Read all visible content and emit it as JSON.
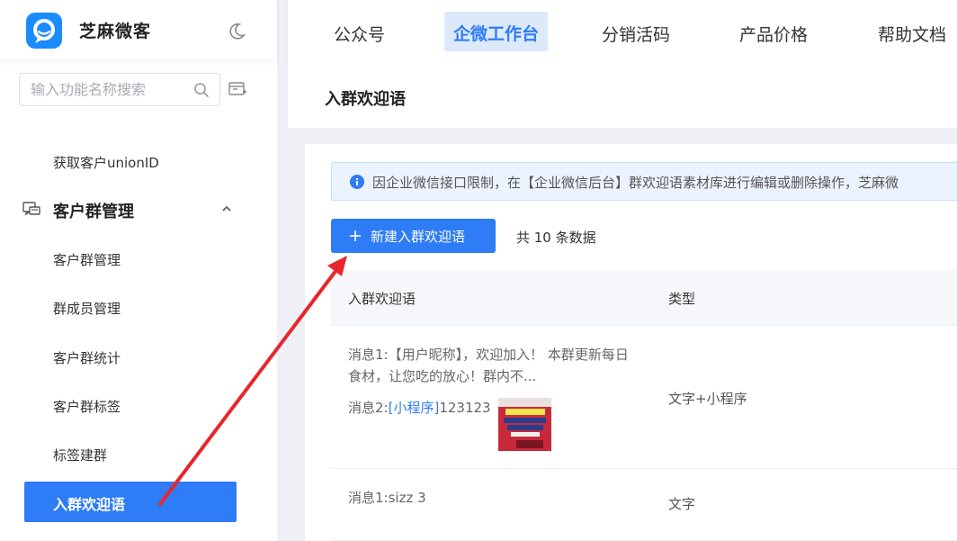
{
  "brand": {
    "name": "芝麻微客"
  },
  "search": {
    "placeholder": "输入功能名称搜索"
  },
  "sidebar": {
    "item_unionid": "获取客户unionID",
    "group_title": "客户群管理",
    "items": [
      {
        "label": "客户群管理"
      },
      {
        "label": "群成员管理"
      },
      {
        "label": "客户群统计"
      },
      {
        "label": "客户群标签"
      },
      {
        "label": "标签建群"
      }
    ],
    "active_label": "入群欢迎语"
  },
  "topnav": {
    "tabs": [
      {
        "label": "公众号"
      },
      {
        "label": "企微工作台"
      },
      {
        "label": "分销活码"
      },
      {
        "label": "产品价格"
      },
      {
        "label": "帮助文档"
      }
    ],
    "active_index": 1
  },
  "page": {
    "title": "入群欢迎语"
  },
  "notice": {
    "text": "因企业微信接口限制，在【企业微信后台】群欢迎语素材库进行编辑或删除操作，芝麻微"
  },
  "toolbar": {
    "new_label": "新建入群欢迎语",
    "count_text": "共 10 条数据"
  },
  "table": {
    "columns": [
      "入群欢迎语",
      "类型"
    ],
    "rows": [
      {
        "msg1": "消息1:【用户昵称】，欢迎加入！ 本群更新每日食材，让您吃的放心！群内不...",
        "msg2_prefix": "消息2:",
        "msg2_link": "[小程序]",
        "msg2_suffix": "123123",
        "type": "文字+小程序"
      },
      {
        "msg1": "消息1:sizz 3",
        "type": "文字"
      }
    ]
  },
  "colors": {
    "accent": "#2e7cf6",
    "annotation": "#e8262b"
  }
}
